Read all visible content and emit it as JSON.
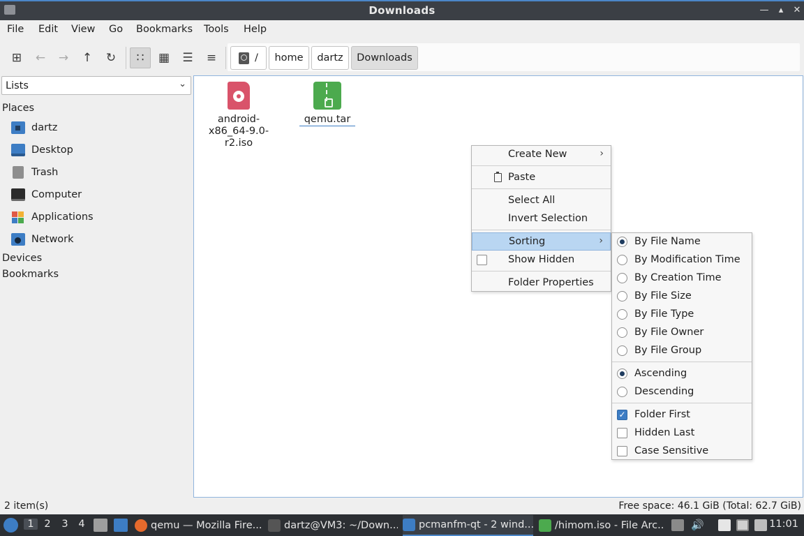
{
  "window": {
    "title": "Downloads"
  },
  "menubar": {
    "items": [
      "File",
      "Edit",
      "View",
      "Go",
      "Bookmarks",
      "Tools",
      "Help"
    ]
  },
  "pathbar": {
    "crumbs": [
      "/",
      "home",
      "dartz",
      "Downloads"
    ]
  },
  "sidepane": {
    "selector": "Lists",
    "places_heading": "Places",
    "places": [
      "dartz",
      "Desktop",
      "Trash",
      "Computer",
      "Applications",
      "Network"
    ],
    "devices_heading": "Devices",
    "bookmarks_heading": "Bookmarks"
  },
  "files": [
    {
      "name_line1": "android-",
      "name_line2": "x86_64-9.0-r2.iso",
      "type": "iso"
    },
    {
      "name_line1": "qemu.tar",
      "type": "tar"
    }
  ],
  "context_menu": {
    "create_new": "Create New",
    "paste": "Paste",
    "select_all": "Select All",
    "invert_selection": "Invert Selection",
    "sorting": "Sorting",
    "show_hidden": "Show Hidden",
    "folder_properties": "Folder Properties"
  },
  "sorting_menu": {
    "by_file_name": "By File Name",
    "by_modification_time": "By Modification Time",
    "by_creation_time": "By Creation Time",
    "by_file_size": "By File Size",
    "by_file_type": "By File Type",
    "by_file_owner": "By File Owner",
    "by_file_group": "By File Group",
    "ascending": "Ascending",
    "descending": "Descending",
    "folder_first": "Folder First",
    "hidden_last": "Hidden Last",
    "case_sensitive": "Case Sensitive"
  },
  "statusbar": {
    "items": "2 item(s)",
    "free_space": "Free space: 46.1 GiB (Total: 62.7 GiB)"
  },
  "taskbar": {
    "workspaces": [
      "1",
      "2",
      "3",
      "4"
    ],
    "tasks": [
      "qemu — Mozilla Fire...",
      "dartz@VM3: ~/Down...",
      "pcmanfm-qt - 2 wind...",
      "/himom.iso - File Arc..."
    ],
    "clock": "11:01"
  },
  "colors": {
    "accent": "#4b86c8",
    "highlight": "#b9d6f2",
    "titlebar": "#3b3f45",
    "taskbar": "#2c2f33"
  }
}
